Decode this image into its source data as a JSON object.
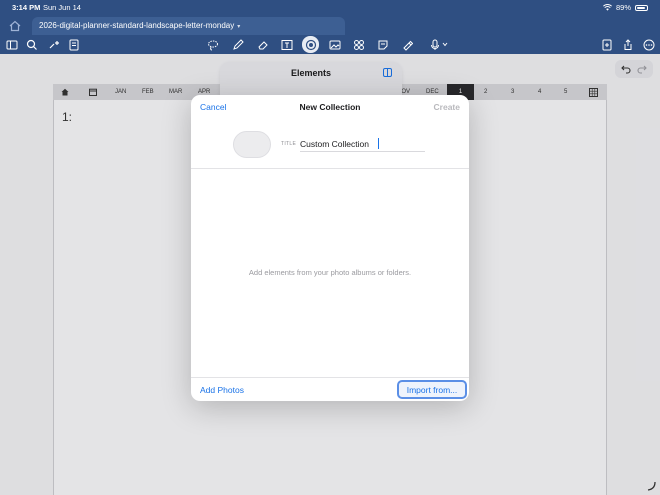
{
  "status_bar": {
    "time": "3:14 PM",
    "date": "Sun Jun 14",
    "battery": "89%",
    "icons": [
      "wifi-icon",
      "battery-icon"
    ]
  },
  "tab_bar": {
    "home_icon": "home-icon",
    "document_tab": "2026-digital-planner-standard-landscape-letter-monday"
  },
  "toolbar": {
    "icons": [
      "sidebar-icon",
      "search-icon",
      "bookmark-add-icon",
      "outline-icon",
      "lasso-icon",
      "pen-icon",
      "eraser-icon",
      "text-frame-icon",
      "elements-icon",
      "image-icon",
      "shapes-icon",
      "sticky-note-icon",
      "highlighter-icon",
      "microphone-icon",
      "new-page-icon",
      "share-icon",
      "more-icon"
    ],
    "active_tool": "elements-icon"
  },
  "planner_nav": {
    "months": [
      "JAN",
      "FEB",
      "MAR",
      "APR",
      "NOV",
      "DEC"
    ],
    "weeks": [
      "1",
      "2",
      "3",
      "4",
      "5"
    ],
    "selected_week": "1",
    "day_label": "1:"
  },
  "elements_panel": {
    "title": "Elements"
  },
  "new_collection_dialog": {
    "cancel_label": "Cancel",
    "title": "New Collection",
    "create_label": "Create",
    "title_field_label": "TITLE",
    "title_field_value": "Custom Collection",
    "empty_message": "Add elements from your photo albums or folders.",
    "add_photos_label": "Add Photos",
    "import_label": "Import from..."
  },
  "colors": {
    "app_bar": "#2f4f82",
    "accent": "#1a73e8",
    "selected_week_bg": "#2b2b2e"
  }
}
